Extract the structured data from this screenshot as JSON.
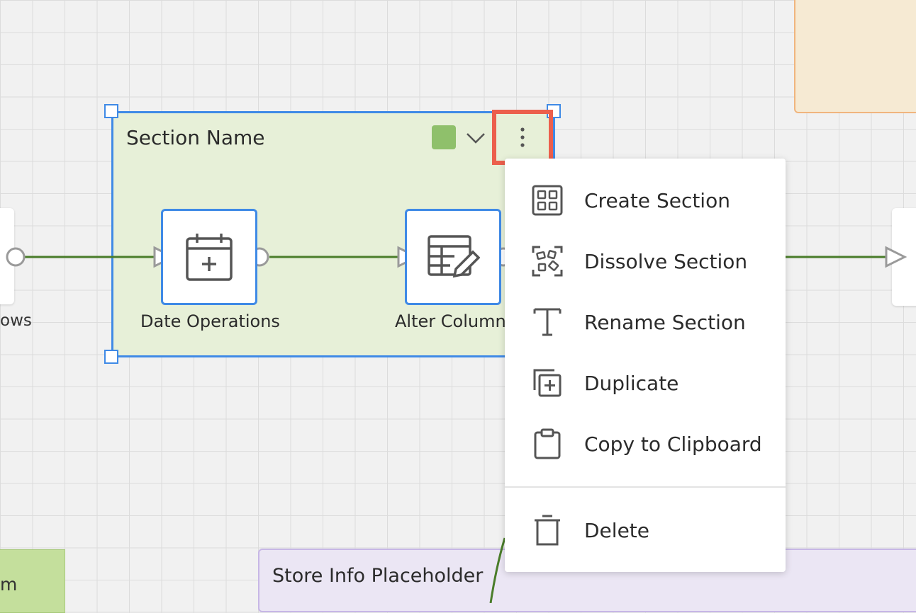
{
  "section": {
    "title": "Section Name",
    "color": "#8fc06b"
  },
  "nodes": {
    "date_operations": {
      "label": "Date Operations",
      "icon": "calendar-plus-icon"
    },
    "alter_columns": {
      "label": "Alter Column",
      "icon": "table-edit-icon"
    }
  },
  "partial_labels": {
    "left_node": "ows",
    "bottom_left_section": "m",
    "bottom_section": "Store Info Placeholder"
  },
  "context_menu": {
    "items": [
      {
        "label": "Create Section",
        "icon": "create-section-icon"
      },
      {
        "label": "Dissolve Section",
        "icon": "dissolve-section-icon"
      },
      {
        "label": "Rename Section",
        "icon": "rename-text-icon"
      },
      {
        "label": "Duplicate",
        "icon": "duplicate-icon"
      },
      {
        "label": "Copy to Clipboard",
        "icon": "clipboard-icon"
      }
    ],
    "delete": {
      "label": "Delete",
      "icon": "trash-icon"
    }
  },
  "colors": {
    "selection": "#3f8ae6",
    "highlight": "#ec5f4c",
    "connector": "#4a7d2a"
  }
}
